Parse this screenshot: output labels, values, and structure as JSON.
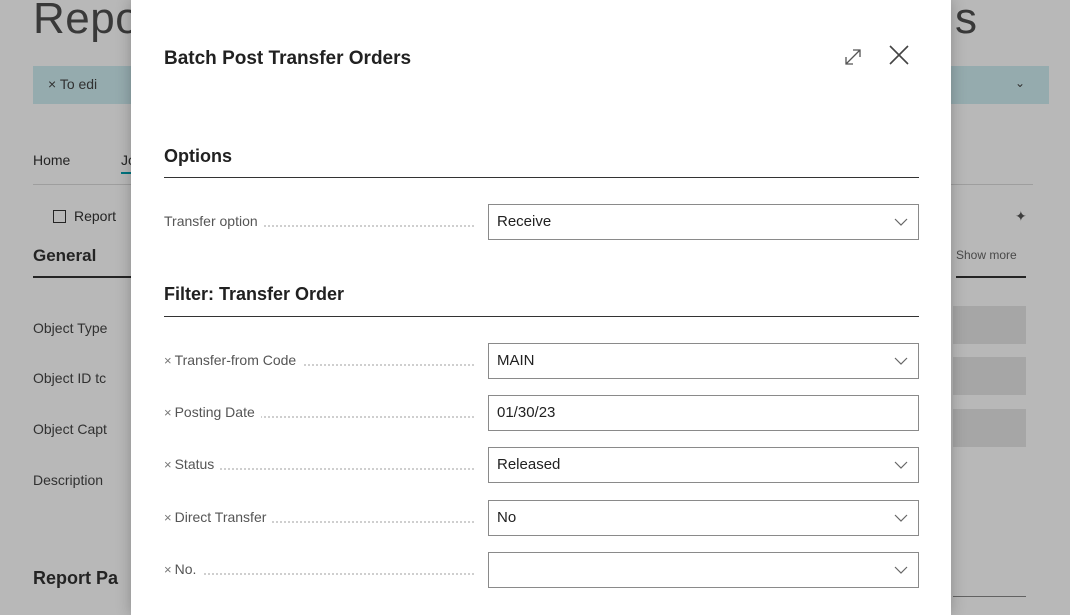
{
  "background": {
    "title_left": "Repo",
    "title_right": "s",
    "banner_text": "× To edi",
    "tab_home": "Home",
    "tab_jo": "Jo",
    "report_button": "Report",
    "section_general": "General",
    "show_more": "Show more",
    "fields": [
      "Object Type",
      "Object ID tc",
      "Object Capt",
      "Description"
    ],
    "section_report": "Report Pa"
  },
  "dialog": {
    "title": "Batch Post Transfer Orders",
    "options_section": "Options",
    "options_fields": [
      {
        "label": "Transfer option",
        "value": "Receive",
        "type": "dropdown"
      }
    ],
    "filter_section": "Filter: Transfer Order",
    "filter_fields": [
      {
        "label": "Transfer-from Code",
        "value": "MAIN",
        "type": "dropdown"
      },
      {
        "label": "Posting Date",
        "value": "01/30/23",
        "type": "text"
      },
      {
        "label": "Status",
        "value": "Released",
        "type": "dropdown"
      },
      {
        "label": "Direct Transfer",
        "value": "No",
        "type": "dropdown"
      },
      {
        "label": "No.",
        "value": "",
        "type": "dropdown"
      }
    ]
  },
  "icons": {
    "expand": "expand-icon",
    "close": "close-icon",
    "chevron": "chevron-down-icon",
    "remove_filter": "remove-filter-x-icon"
  },
  "colors": {
    "banner": "#cfeef2",
    "accent": "#00a1b0",
    "overlay": "rgba(0,0,0,0.28)"
  }
}
